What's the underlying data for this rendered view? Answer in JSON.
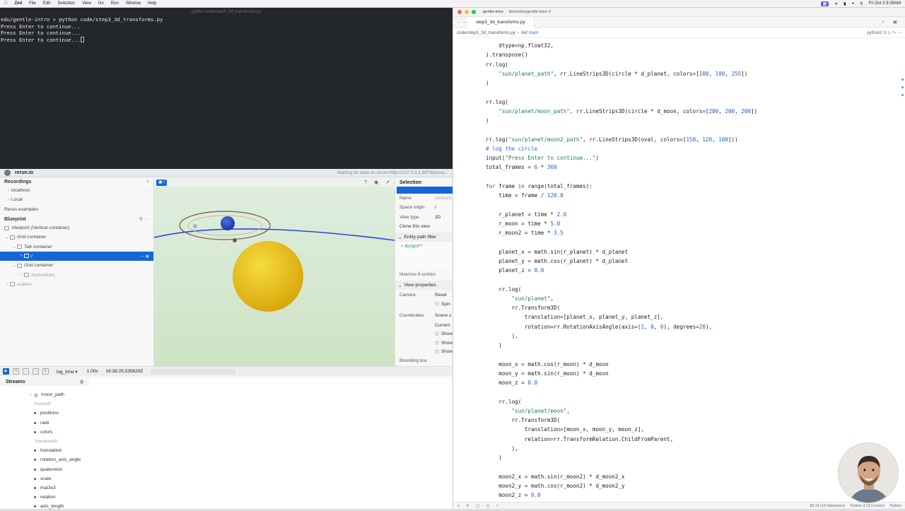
{
  "menubar": {
    "app": "Zed",
    "items": [
      "File",
      "Edit",
      "Selection",
      "View",
      "Go",
      "Run",
      "Window",
      "Help"
    ],
    "clock": "Fri Oct 3  9:39AM"
  },
  "terminal": {
    "title": "python code/step3_3d_transforms.py",
    "lines": [
      "edu/gentle-intro » python code/step3_3d_transforms.py",
      "Press Enter to continue...",
      "Press Enter to continue...",
      "Press Enter to continue..."
    ]
  },
  "rerun": {
    "app_name": "rerun.io",
    "status": "Waiting for data on rerun+http://127.0.0.1:9876/proxy...",
    "recordings_title": "Recordings",
    "recordings": [
      "localhost",
      "Local"
    ],
    "rerun_examples": "Rerun examples",
    "blueprint_title": "Blueprint",
    "tree": {
      "viewport": "Viewport (Vertical container)",
      "grid1": "Grid container",
      "tab": "Tab container",
      "root": "/",
      "grid2": "Grid container",
      "instructions": "Instructions",
      "scalars": "scalars"
    },
    "view_chip": "/",
    "selection": {
      "title": "Selection",
      "name_k": "Name",
      "name_v": "(default)",
      "space_k": "Space origin",
      "space_v": "/",
      "type_k": "View type",
      "type_v": "3D",
      "clone": "Clone this view",
      "filter_title": "Entity path filter",
      "filter_value": "+ $origin/**",
      "matches": "Matches 8 entities",
      "view_props": "View properties",
      "camera_k": "Camera",
      "camera_v": "Reset",
      "spin": "Spin",
      "coords_k": "Coordinates",
      "coords_v": "Scene u",
      "current": "Current",
      "show1": "Show",
      "show2": "Show",
      "show3": "Show",
      "bbox": "Bounding box"
    },
    "timeline": {
      "timeline_name": "log_time",
      "speed": "1.00x",
      "time": "16:38:25.535629Z"
    },
    "streams": {
      "title": "Streams",
      "rows": [
        {
          "kind": "entity",
          "label": "moon_path"
        },
        {
          "kind": "group",
          "label": "Points3D"
        },
        {
          "kind": "field",
          "label": "positions"
        },
        {
          "kind": "field",
          "label": "radii"
        },
        {
          "kind": "field",
          "label": "colors"
        },
        {
          "kind": "group",
          "label": "Transform3D"
        },
        {
          "kind": "field",
          "label": "translation"
        },
        {
          "kind": "field",
          "label": "rotation_axis_angle"
        },
        {
          "kind": "field",
          "label": "quaternion"
        },
        {
          "kind": "field",
          "label": "scale"
        },
        {
          "kind": "field",
          "label": "mat3x3"
        },
        {
          "kind": "field",
          "label": "relation"
        },
        {
          "kind": "field",
          "label": "axis_length"
        }
      ]
    }
  },
  "editor": {
    "project": "gentle-intro",
    "branch": "blchmbrs/gentle-intro-2",
    "tab": "step3_3d_transforms.py",
    "breadcrumb_file": "code/step3_3d_transforms.py",
    "breadcrumb_sep": "›",
    "breadcrumb_fn": "def main",
    "kernel": "python3",
    "status_pos": "65:14 (10 characters)",
    "status_lang_ver": "Python 3.13.5 (venv)",
    "status_lang": "Python"
  },
  "code": [
    [
      [
        "    dtype=np.float32,",
        ""
      ]
    ],
    [
      [
        ").transpose()",
        ""
      ]
    ],
    [
      [
        "rr.log(",
        ""
      ]
    ],
    [
      [
        "    ",
        ""
      ],
      [
        "\"sun/planet_path\"",
        "s"
      ],
      [
        ", rr.LineStrips3D(circle * d_planet, colors=[",
        ""
      ],
      [
        "100",
        "n"
      ],
      [
        ", ",
        ""
      ],
      [
        "100",
        "n"
      ],
      [
        ", ",
        ""
      ],
      [
        "255",
        "n"
      ],
      [
        "])",
        ""
      ]
    ],
    [
      [
        ")",
        ""
      ]
    ],
    [
      [
        "",
        ""
      ]
    ],
    [
      [
        "rr.log(",
        ""
      ]
    ],
    [
      [
        "    ",
        ""
      ],
      [
        "\"sun/planet/moon_path\"",
        "s"
      ],
      [
        ", rr.LineStrips3D(circle * d_moon, colors=[",
        ""
      ],
      [
        "200",
        "n"
      ],
      [
        ", ",
        ""
      ],
      [
        "200",
        "n"
      ],
      [
        ", ",
        ""
      ],
      [
        "200",
        "n"
      ],
      [
        "])",
        ""
      ]
    ],
    [
      [
        ")",
        ""
      ]
    ],
    [
      [
        "",
        ""
      ]
    ],
    [
      [
        "rr.log(",
        ""
      ],
      [
        "\"sun/planet/moon2_path\"",
        "s"
      ],
      [
        ", rr.LineStrips3D(oval, colors=[",
        ""
      ],
      [
        "150",
        "n"
      ],
      [
        ", ",
        ""
      ],
      [
        "120",
        "n"
      ],
      [
        ", ",
        ""
      ],
      [
        "100",
        "n"
      ],
      [
        "]))",
        ""
      ]
    ],
    [
      [
        "# log the circle",
        "c"
      ]
    ],
    [
      [
        "input(",
        ""
      ],
      [
        "\"Press Enter to continue...\"",
        "s"
      ],
      [
        ")",
        ""
      ]
    ],
    [
      [
        "total_frames = ",
        ""
      ],
      [
        "6",
        "n"
      ],
      [
        " * ",
        ""
      ],
      [
        "360",
        "n"
      ]
    ],
    [
      [
        "",
        ""
      ]
    ],
    [
      [
        "for",
        "k"
      ],
      [
        " frame ",
        ""
      ],
      [
        "in",
        "k"
      ],
      [
        " range(total_frames):",
        ""
      ]
    ],
    [
      [
        "    time = frame / ",
        ""
      ],
      [
        "120.0",
        "n"
      ]
    ],
    [
      [
        "",
        ""
      ]
    ],
    [
      [
        "    r_planet = time * ",
        ""
      ],
      [
        "2.0",
        "n"
      ]
    ],
    [
      [
        "    r_moon = time * ",
        ""
      ],
      [
        "5.0",
        "n"
      ]
    ],
    [
      [
        "    r_moon2 = time * ",
        ""
      ],
      [
        "3.5",
        "n"
      ]
    ],
    [
      [
        "",
        ""
      ]
    ],
    [
      [
        "    planet_x = math.sin(r_planet) * d_planet",
        ""
      ]
    ],
    [
      [
        "    planet_y = math.cos(r_planet) * d_planet",
        ""
      ]
    ],
    [
      [
        "    planet_z = ",
        ""
      ],
      [
        "0.0",
        "n"
      ]
    ],
    [
      [
        "",
        ""
      ]
    ],
    [
      [
        "    rr.log(",
        ""
      ]
    ],
    [
      [
        "        ",
        ""
      ],
      [
        "\"sun/planet\"",
        "s"
      ],
      [
        ",",
        ""
      ]
    ],
    [
      [
        "        rr.Transform3D(",
        ""
      ]
    ],
    [
      [
        "            translation=[planet_x, planet_y, planet_z],",
        ""
      ]
    ],
    [
      [
        "            rotation=rr.RotationAxisAngle(axis=(",
        ""
      ],
      [
        "1",
        "n"
      ],
      [
        ", ",
        ""
      ],
      [
        "0",
        "n"
      ],
      [
        ", ",
        ""
      ],
      [
        "0",
        "n"
      ],
      [
        "), degrees=",
        ""
      ],
      [
        "20",
        "n"
      ],
      [
        "),",
        ""
      ]
    ],
    [
      [
        "        ),",
        ""
      ]
    ],
    [
      [
        "    )",
        ""
      ]
    ],
    [
      [
        "",
        ""
      ]
    ],
    [
      [
        "    moon_x = math.cos(r_moon) * d_moon",
        ""
      ]
    ],
    [
      [
        "    moon_y = math.sin(r_moon) * d_moon",
        ""
      ]
    ],
    [
      [
        "    moon_z = ",
        ""
      ],
      [
        "0.0",
        "n"
      ]
    ],
    [
      [
        "",
        ""
      ]
    ],
    [
      [
        "    rr.log(",
        ""
      ]
    ],
    [
      [
        "        ",
        ""
      ],
      [
        "\"sun/planet/moon\"",
        "s"
      ],
      [
        ",",
        ""
      ]
    ],
    [
      [
        "        rr.Transform3D(",
        ""
      ]
    ],
    [
      [
        "            translation=[moon_x, moon_y, moon_z],",
        ""
      ]
    ],
    [
      [
        "            relation=rr.TransformRelation.ChildFromParent,",
        ""
      ]
    ],
    [
      [
        "        ),",
        ""
      ]
    ],
    [
      [
        "    )",
        ""
      ]
    ],
    [
      [
        "",
        ""
      ]
    ],
    [
      [
        "    moon2_x = math.sin(r_moon2) * d_moon2_x",
        ""
      ]
    ],
    [
      [
        "    moon2_y = math.cos(r_moon2) * d_moon2_y",
        ""
      ]
    ],
    [
      [
        "    moon2_z = ",
        ""
      ],
      [
        "0.0",
        "n"
      ]
    ]
  ],
  "colors": {
    "accent": "#1565d8",
    "terminal_bg": "#23262b",
    "sun": "#f0c419",
    "planet": "#2a4fc9",
    "orbit": "#8a6a50",
    "sky_line": "#2d45e0"
  }
}
